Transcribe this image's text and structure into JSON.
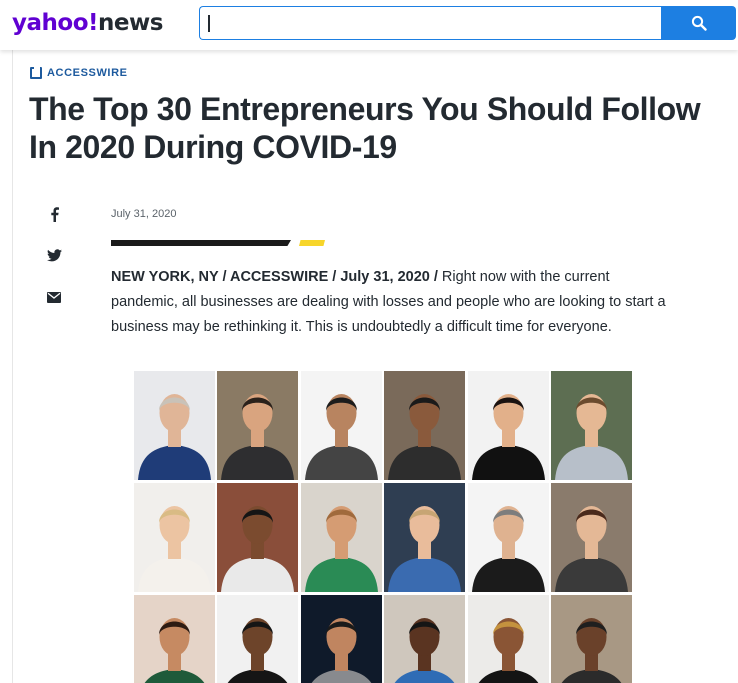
{
  "header": {
    "logo_yahoo": "yahoo!",
    "logo_news": "news",
    "search_value": "",
    "search_icon": "search-icon",
    "accent_color": "#1d7fe2",
    "brand_color": "#6001d2"
  },
  "article": {
    "source": "ACCESSWIRE",
    "source_color": "#1d5a9e",
    "title": "The Top 30 Entrepreneurs You Should Follow In 2020 During COVID-19",
    "date": "July 31, 2020",
    "dateline": "NEW YORK, NY / ACCESSWIRE / July 31, 2020 /",
    "lead_text": " Right now with the current pandemic, all businesses are dealing with losses and people who are looking to start a business may be rethinking it. This is undoubtedly a difficult time for everyone.",
    "rule_colors": [
      "#1a1a1a",
      "#f7d52a"
    ]
  },
  "share": [
    {
      "name": "facebook",
      "icon": "facebook-icon"
    },
    {
      "name": "twitter",
      "icon": "twitter-icon"
    },
    {
      "name": "email",
      "icon": "mail-icon"
    }
  ],
  "collage": {
    "rows": 3,
    "columns": 6,
    "portraits": [
      {
        "bg": "#e8e9ec",
        "skin": "#e0b597",
        "hair": "#c9c2b8",
        "shirt": "#1f3c78"
      },
      {
        "bg": "#8a7a64",
        "skin": "#d9a47f",
        "hair": "#2a211b",
        "shirt": "#2e2e30"
      },
      {
        "bg": "#f4f4f4",
        "skin": "#b88460",
        "hair": "#1c1c1c",
        "shirt": "#444444"
      },
      {
        "bg": "#7a6a5a",
        "skin": "#8a5a3c",
        "hair": "#1a1a1a",
        "shirt": "#2d2d2d"
      },
      {
        "bg": "#f2f2f2",
        "skin": "#e2b08a",
        "hair": "#1a1210",
        "shirt": "#111111"
      },
      {
        "bg": "#5d6e52",
        "skin": "#e5b894",
        "hair": "#6b4b2e",
        "shirt": "#b7bfc9"
      },
      {
        "bg": "#f1efec",
        "skin": "#ecc4a2",
        "hair": "#d9bb84",
        "shirt": "#f4f1ec"
      },
      {
        "bg": "#8a4e3a",
        "skin": "#7b4b2f",
        "hair": "#151515",
        "shirt": "#e9e9e9"
      },
      {
        "bg": "#d9d4cc",
        "skin": "#d59c73",
        "hair": "#a06a3c",
        "shirt": "#2a8b55"
      },
      {
        "bg": "#2f3e52",
        "skin": "#e9bc9b",
        "hair": "#c7a574",
        "shirt": "#3a6bb0"
      },
      {
        "bg": "#f4f4f4",
        "skin": "#dfb290",
        "hair": "#7d7d7d",
        "shirt": "#1b1b1b"
      },
      {
        "bg": "#8a7b6c",
        "skin": "#e4b896",
        "hair": "#4a2a1c",
        "shirt": "#3a3a3a"
      },
      {
        "bg": "#e5d4c8",
        "skin": "#c68a62",
        "hair": "#2d1b12",
        "shirt": "#1f5a3a"
      },
      {
        "bg": "#f1f1f1",
        "skin": "#6d442a",
        "hair": "#151515",
        "shirt": "#151515"
      },
      {
        "bg": "#0f1a2a",
        "skin": "#c08560",
        "hair": "#1a1a1a",
        "shirt": "#888a8e"
      },
      {
        "bg": "#cfc7bd",
        "skin": "#5a3421",
        "hair": "#151515",
        "shirt": "#2f6cb5"
      },
      {
        "bg": "#ecebe9",
        "skin": "#8a5535",
        "hair": "#c4923e",
        "shirt": "#141414"
      },
      {
        "bg": "#a89884",
        "skin": "#6a412a",
        "hair": "#1f1f1f",
        "shirt": "#2b2b2b"
      }
    ]
  }
}
